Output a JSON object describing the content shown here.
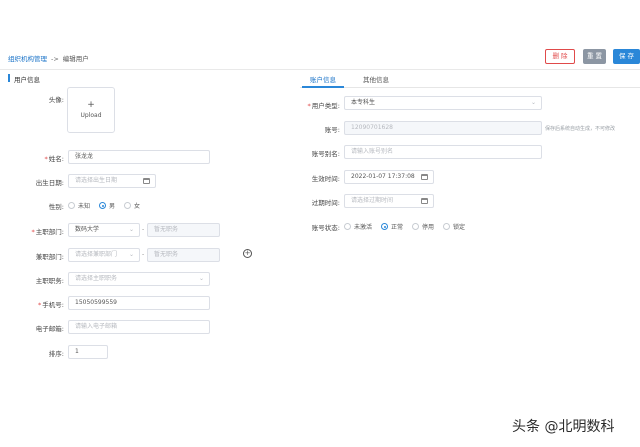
{
  "breadcrumb": {
    "parent": "组织机构管理",
    "separator": "->",
    "current": "编辑用户"
  },
  "toolbar": {
    "delete_label": "删 除",
    "reset_label": "重 置",
    "save_label": "保 存"
  },
  "left": {
    "section_title": "用户信息",
    "avatar": {
      "label": "头像:",
      "plus": "+",
      "upload_text": "Upload"
    },
    "name": {
      "label": "姓名:",
      "value": "张龙龙"
    },
    "birthday": {
      "label": "出生日期:",
      "placeholder": "请选择出生日期"
    },
    "gender": {
      "label": "性别:",
      "options": [
        "未知",
        "男",
        "女"
      ],
      "selected": "男"
    },
    "main_dept": {
      "label": "主职部门:",
      "value": "数码大学",
      "post_placeholder": "暂无职务"
    },
    "part_dept": {
      "label": "兼职部门:",
      "placeholder": "请选择兼职部门",
      "post_placeholder": "暂无职务"
    },
    "main_post": {
      "label": "主职职务:",
      "placeholder": "请选择主职职务"
    },
    "phone": {
      "label": "手机号:",
      "value": "15050599559"
    },
    "email": {
      "label": "电子邮箱:",
      "placeholder": "请输入电子邮箱"
    },
    "sort": {
      "label": "排序:",
      "value": "1"
    },
    "dash": "-",
    "add_icon": "+"
  },
  "right": {
    "tabs": [
      {
        "label": "账户信息"
      },
      {
        "label": "其他信息"
      }
    ],
    "user_type": {
      "label": "用户类型:",
      "value": "本专科生"
    },
    "account": {
      "label": "账号:",
      "value": "12090701628",
      "hint": "保存后系统自动生成，不可修改"
    },
    "alias": {
      "label": "账号别名:",
      "placeholder": "请输入账号别名"
    },
    "effective_time": {
      "label": "生效时间:",
      "value": "2022-01-07 17:37:08"
    },
    "expire_time": {
      "label": "过期时间:",
      "placeholder": "请选择过期时间"
    },
    "status": {
      "label": "账号状态:",
      "options": [
        "未激活",
        "正常",
        "停用",
        "锁定"
      ],
      "selected": "正常"
    }
  },
  "watermark": "头条 @北明数科",
  "colors": {
    "primary": "#2a87d8",
    "danger": "#e04a4a",
    "reset": "#8c96a3"
  }
}
